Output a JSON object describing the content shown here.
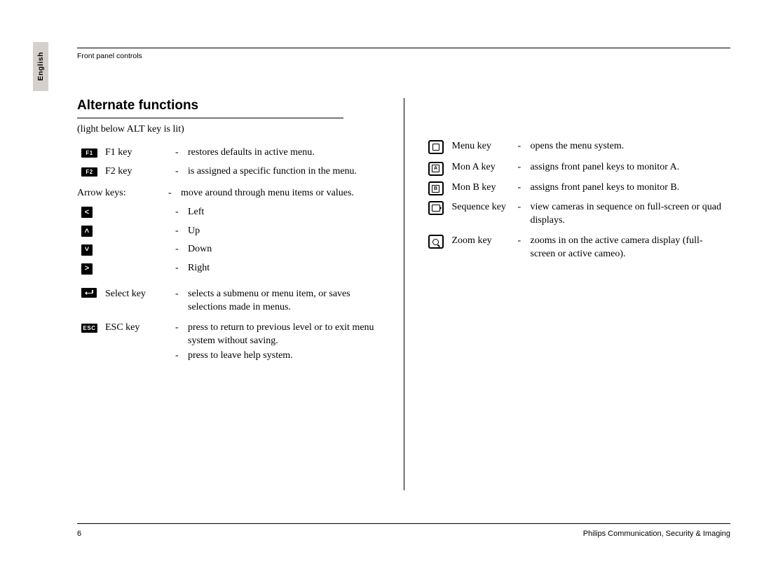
{
  "sideTab": "English",
  "breadcrumb": "Front panel controls",
  "sectionTitle": "Alternate functions",
  "subtitle": "(light below ALT key is lit)",
  "left": {
    "f1": {
      "label": "F1",
      "name": "F1 key",
      "desc": "restores defaults in active menu."
    },
    "f2": {
      "label": "F2",
      "name": "F2 key",
      "desc": "is assigned a specific function in the menu."
    },
    "arrowHeader": {
      "name": "Arrow keys:",
      "desc": "move around through menu items or values."
    },
    "left": {
      "desc": "Left"
    },
    "up": {
      "desc": "Up"
    },
    "down": {
      "desc": "Down"
    },
    "right": {
      "desc": "Right"
    },
    "select": {
      "name": "Select key",
      "desc": "selects a submenu or menu item, or saves selections made in menus."
    },
    "esc": {
      "label": "ESC",
      "name": "ESC key",
      "desc1": "press to return to previous level or to exit menu system without saving.",
      "desc2": "press to leave help system."
    }
  },
  "right": {
    "menu": {
      "name": "Menu key",
      "desc": "opens the menu system."
    },
    "mona": {
      "name": "Mon A key",
      "letter": "A",
      "desc": "assigns front panel keys to monitor A."
    },
    "monb": {
      "name": "Mon B key",
      "letter": "B",
      "desc": "assigns front panel keys to monitor B."
    },
    "seq": {
      "name": "Sequence key",
      "desc": "view cameras in sequence on full-screen or quad displays."
    },
    "zoom": {
      "name": "Zoom key",
      "desc": "zooms in on the active camera display (full-screen or active cameo)."
    }
  },
  "pageNumber": "6",
  "footer": "Philips Communication, Security & Imaging"
}
